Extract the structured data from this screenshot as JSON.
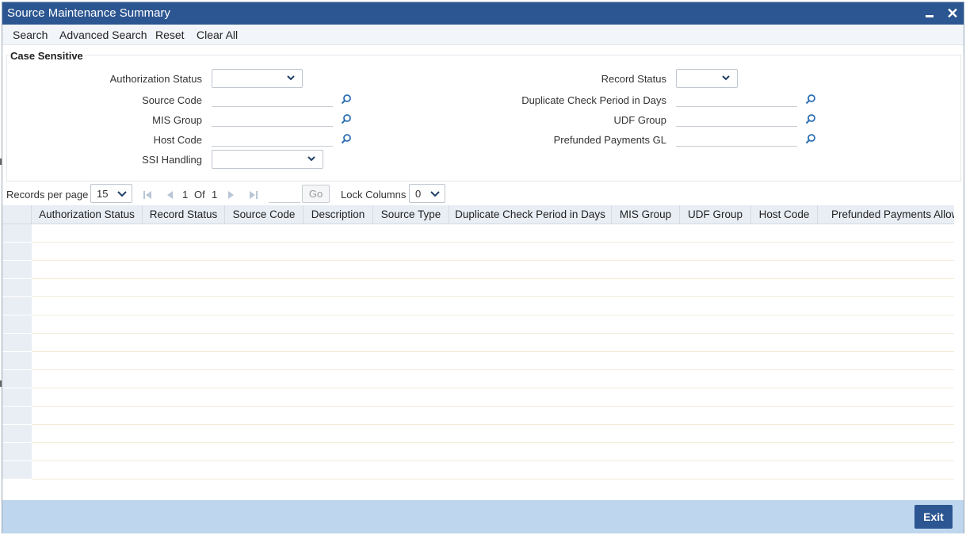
{
  "window": {
    "title": "Source Maintenance Summary"
  },
  "toolbar": {
    "search": "Search",
    "advanced_search": "Advanced Search",
    "reset": "Reset",
    "clear_all": "Clear All"
  },
  "criteria": {
    "section_title": "Case Sensitive",
    "authorization_status": {
      "label": "Authorization Status",
      "value": ""
    },
    "record_status": {
      "label": "Record Status",
      "value": ""
    },
    "source_code": {
      "label": "Source Code",
      "value": ""
    },
    "duplicate_check_period": {
      "label": "Duplicate Check Period in Days",
      "value": ""
    },
    "mis_group": {
      "label": "MIS Group",
      "value": ""
    },
    "udf_group": {
      "label": "UDF Group",
      "value": ""
    },
    "host_code": {
      "label": "Host Code",
      "value": ""
    },
    "prefunded_payments_gl": {
      "label": "Prefunded Payments GL",
      "value": ""
    },
    "ssi_handling": {
      "label": "SSI Handling",
      "value": ""
    }
  },
  "pager": {
    "records_per_page_label": "Records per page",
    "records_per_page": "15",
    "current_page": "1",
    "of_label": "Of",
    "total_pages": "1",
    "go_label": "Go",
    "lock_columns_label": "Lock Columns",
    "lock_columns": "0"
  },
  "grid": {
    "columns": [
      "Authorization Status",
      "Record Status",
      "Source Code",
      "Description",
      "Source Type",
      "Duplicate Check Period in Days",
      "MIS Group",
      "UDF Group",
      "Host Code",
      "Prefunded Payments Allowed"
    ],
    "rows": []
  },
  "footer": {
    "exit": "Exit"
  },
  "colors": {
    "titlebar": "#2c5691",
    "footer": "#bed6ee",
    "header": "#e9eef5",
    "icon": "#2c6fb3"
  },
  "icons": [
    "minimize-icon",
    "close-icon",
    "chevron-down-icon",
    "lookup-search-icon",
    "first-page-icon",
    "prev-page-icon",
    "next-page-icon",
    "last-page-icon"
  ]
}
